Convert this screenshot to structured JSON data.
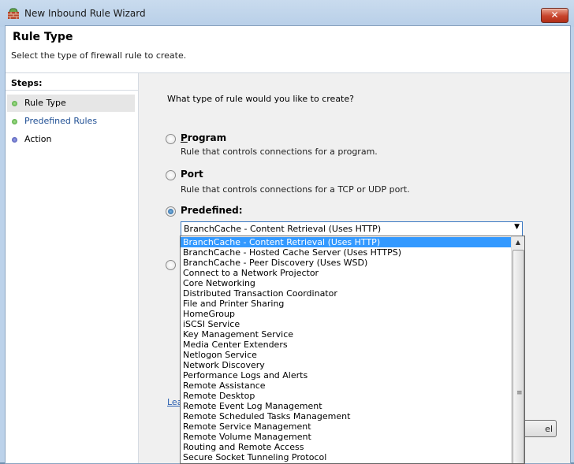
{
  "window": {
    "title": "New Inbound Rule Wizard",
    "close_glyph": "✕"
  },
  "header": {
    "title": "Rule Type",
    "subtitle": "Select the type of firewall rule to create."
  },
  "steps": {
    "title": "Steps:",
    "items": [
      {
        "label": "Rule Type",
        "color": "#4caf3c",
        "active": true
      },
      {
        "label": "Predefined Rules",
        "color": "#4caf3c",
        "active": false
      },
      {
        "label": "Action",
        "color": "#4a55b8",
        "active": false
      }
    ]
  },
  "main": {
    "question": "What type of rule would you like to create?",
    "options": [
      {
        "label": "Program",
        "accel": "P",
        "rest": "rogram",
        "description": "Rule that controls connections for a program.",
        "checked": false
      },
      {
        "label": "Port",
        "accel": "o",
        "description": "Rule that controls connections for a TCP or UDP port.",
        "checked": false
      },
      {
        "label": "Predefined:",
        "accel": "r",
        "description": "",
        "checked": true
      }
    ],
    "predefined_value": "BranchCache - Content Retrieval (Uses HTTP)",
    "learn_link": "Lea",
    "cancel_label": "el"
  },
  "dropdown": {
    "selected_index": 0,
    "items": [
      "BranchCache - Content Retrieval (Uses HTTP)",
      "BranchCache - Hosted Cache Server (Uses HTTPS)",
      "BranchCache - Peer Discovery (Uses WSD)",
      "Connect to a Network Projector",
      "Core Networking",
      "Distributed Transaction Coordinator",
      "File and Printer Sharing",
      "HomeGroup",
      "iSCSI Service",
      "Key Management Service",
      "Media Center Extenders",
      "Netlogon Service",
      "Network Discovery",
      "Performance Logs and Alerts",
      "Remote Assistance",
      "Remote Desktop",
      "Remote Event Log Management",
      "Remote Scheduled Tasks Management",
      "Remote Service Management",
      "Remote Volume Management",
      "Routing and Remote Access",
      "Secure Socket Tunneling Protocol"
    ]
  }
}
